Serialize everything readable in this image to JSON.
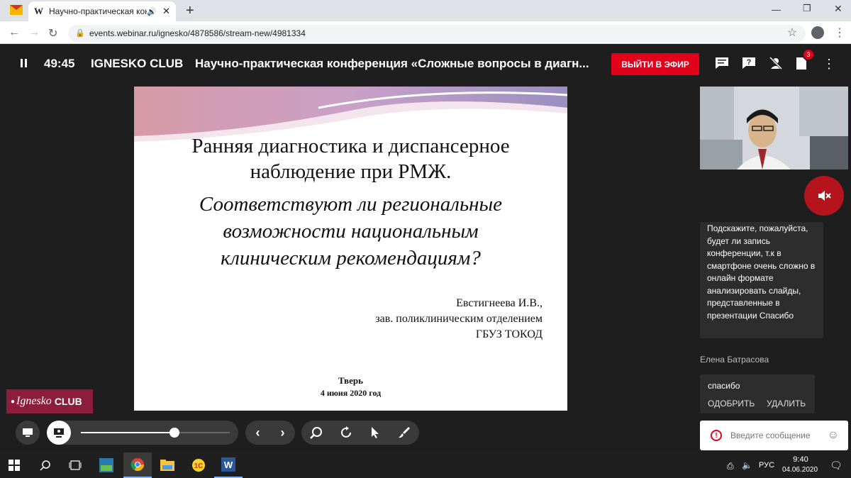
{
  "browser": {
    "tab_title": "Научно-практическая конф",
    "tab_favicon_letter": "W",
    "url": "events.webinar.ru/ignesko/4878586/stream-new/4981334"
  },
  "player": {
    "timer": "49:45",
    "club": "IGNESKO CLUB",
    "event_title": "Научно-практическая конференция «Сложные вопросы в диагн...",
    "onair_label": "ВЫЙТИ В ЭФИР",
    "notification_count": "3"
  },
  "slide": {
    "title_line1": "Ранняя диагностика и диспансерное",
    "title_line2": "наблюдение при РМЖ.",
    "subtitle_line1": "Соответствуют ли региональные",
    "subtitle_line2": "возможности национальным",
    "subtitle_line3": "клиническим рекомендациям?",
    "author": "Евстигнеева И.В.,",
    "position": "зав. поликлиническим отделением",
    "org": "ГБУЗ ТОКОД",
    "city": "Тверь",
    "date": "4 июня 2020 год"
  },
  "logo": {
    "script_text": "Ignesko",
    "bold_text": "CLUB"
  },
  "chat": {
    "message1": "Подскажите, пожалуйста, будет ли запись конференции, т.к в смартфоне очень сложно в онлайн формате анализировать слайды, представленные в презентации Спасибо",
    "author2": "Елена Батрасова",
    "message2": "спасибо",
    "approve_label": "ОДОБРИТЬ",
    "delete_label": "УДАЛИТЬ",
    "input_placeholder": "Введите сообщение"
  },
  "player_controls": {
    "volume_level": 0.63
  },
  "taskbar": {
    "language": "РУС",
    "time": "9:40",
    "date": "04.06.2020"
  },
  "colors": {
    "accent_red": "#e3001b",
    "logo_bg": "#8c1d3c",
    "mute_red": "#b5141c"
  }
}
